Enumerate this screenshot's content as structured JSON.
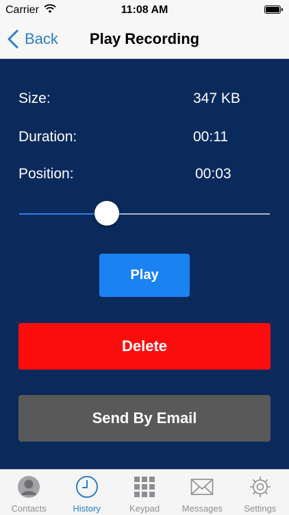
{
  "status_bar": {
    "carrier": "Carrier",
    "time": "11:08 AM"
  },
  "nav": {
    "back_label": "Back",
    "title": "Play Recording"
  },
  "details": [
    {
      "label": "Size:",
      "value": "347 KB"
    },
    {
      "label": "Duration:",
      "value": "00:11"
    },
    {
      "label": "Position:",
      "value": "00:03"
    }
  ],
  "slider": {
    "progress_fraction": 0.35
  },
  "buttons": {
    "play": "Play",
    "delete": "Delete",
    "email": "Send By Email"
  },
  "tabs": [
    {
      "label": "Contacts",
      "icon": "contacts-icon",
      "active": false
    },
    {
      "label": "History",
      "icon": "history-clock-icon",
      "active": true
    },
    {
      "label": "Keypad",
      "icon": "keypad-icon",
      "active": false
    },
    {
      "label": "Messages",
      "icon": "envelope-icon",
      "active": false
    },
    {
      "label": "Settings",
      "icon": "gear-icon",
      "active": false
    }
  ],
  "colors": {
    "background": "#0b2a5c",
    "accent": "#2a7fc2",
    "play": "#1b82f2",
    "delete": "#fc0d0d",
    "email": "#595959"
  }
}
